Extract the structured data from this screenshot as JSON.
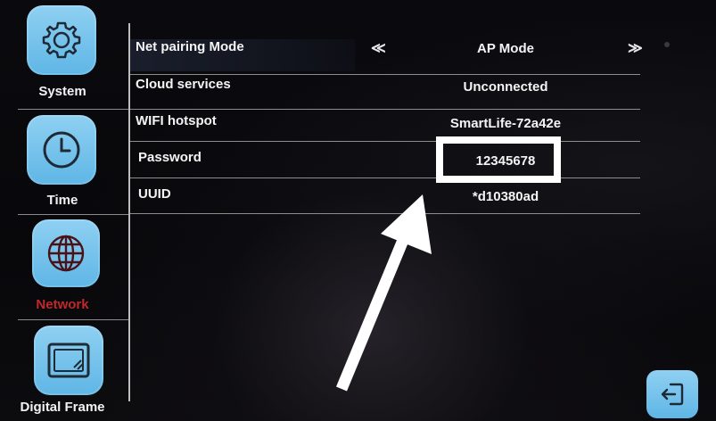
{
  "sidebar": {
    "items": [
      {
        "label": "System",
        "icon": "gear-icon",
        "active": false
      },
      {
        "label": "Time",
        "icon": "clock-icon",
        "active": false
      },
      {
        "label": "Network",
        "icon": "globe-icon",
        "active": true
      },
      {
        "label": "Digital Frame",
        "icon": "picture-frame-icon",
        "active": false
      }
    ]
  },
  "settings": {
    "rows": [
      {
        "label": "Net pairing Mode",
        "value": "AP Mode"
      },
      {
        "label": "Cloud services",
        "value": "Unconnected"
      },
      {
        "label": "WIFI hotspot",
        "value": "SmartLife-72a42e"
      },
      {
        "label": "Password",
        "value": "12345678"
      },
      {
        "label": "UUID",
        "value": "*d10380ad"
      }
    ],
    "prev_arrow": "≪",
    "next_arrow": "≫"
  },
  "exit": {
    "icon": "exit-icon"
  },
  "colors": {
    "tile": "#6fc0ea",
    "active_label": "#c0282a",
    "background": "#08080b"
  }
}
